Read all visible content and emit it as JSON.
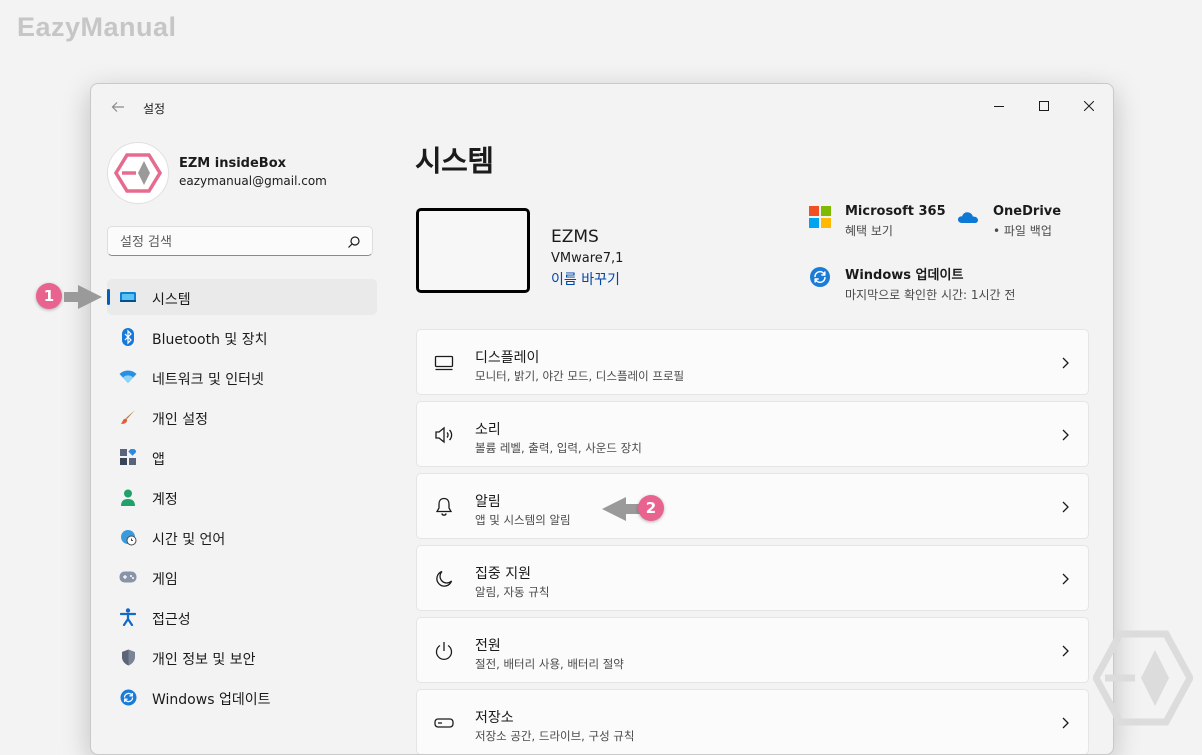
{
  "watermark": "EazyManual",
  "window": {
    "title": "설정",
    "controls": [
      "minimize-icon",
      "maximize-icon",
      "close-icon"
    ]
  },
  "profile": {
    "name": "EZM insideBox",
    "email": "eazymanual@gmail.com"
  },
  "search": {
    "placeholder": "설정 검색"
  },
  "sidebar": {
    "items": [
      {
        "label": "시스템",
        "icon": "monitor-icon",
        "active": true
      },
      {
        "label": "Bluetooth 및 장치",
        "icon": "bluetooth-icon"
      },
      {
        "label": "네트워크 및 인터넷",
        "icon": "wifi-icon"
      },
      {
        "label": "개인 설정",
        "icon": "brush-icon"
      },
      {
        "label": "앱",
        "icon": "apps-icon"
      },
      {
        "label": "계정",
        "icon": "account-icon"
      },
      {
        "label": "시간 및 언어",
        "icon": "globe-clock-icon"
      },
      {
        "label": "게임",
        "icon": "gamepad-icon"
      },
      {
        "label": "접근성",
        "icon": "accessibility-icon"
      },
      {
        "label": "개인 정보 및 보안",
        "icon": "shield-icon"
      },
      {
        "label": "Windows 업데이트",
        "icon": "update-icon"
      }
    ]
  },
  "main": {
    "title": "시스템",
    "device": {
      "name": "EZMS",
      "model": "VMware7,1",
      "rename": "이름 바꾸기"
    },
    "quick": {
      "m365": {
        "title": "Microsoft 365",
        "sub": "혜택 보기"
      },
      "onedrive": {
        "title": "OneDrive",
        "sub": "• 파일 백업"
      },
      "update": {
        "title": "Windows 업데이트",
        "sub": "마지막으로 확인한 시간: 1시간 전"
      }
    },
    "cards": [
      {
        "title": "디스플레이",
        "sub": "모니터, 밝기, 야간 모드, 디스플레이 프로필",
        "icon": "display-icon"
      },
      {
        "title": "소리",
        "sub": "볼륨 레벨, 출력, 입력, 사운드 장치",
        "icon": "speaker-icon"
      },
      {
        "title": "알림",
        "sub": "앱 및 시스템의 알림",
        "icon": "bell-icon"
      },
      {
        "title": "집중 지원",
        "sub": "알림, 자동 규칙",
        "icon": "moon-icon"
      },
      {
        "title": "전원",
        "sub": "절전, 배터리 사용, 배터리 절약",
        "icon": "power-icon"
      },
      {
        "title": "저장소",
        "sub": "저장소 공간, 드라이브, 구성 규칙",
        "icon": "storage-icon"
      }
    ]
  },
  "annotations": {
    "badge1": "1",
    "badge2": "2"
  },
  "colors": {
    "accent": "#005fb8",
    "link": "#0046a8",
    "badge": "#e8638e",
    "logo_pink": "#e56b8f"
  }
}
